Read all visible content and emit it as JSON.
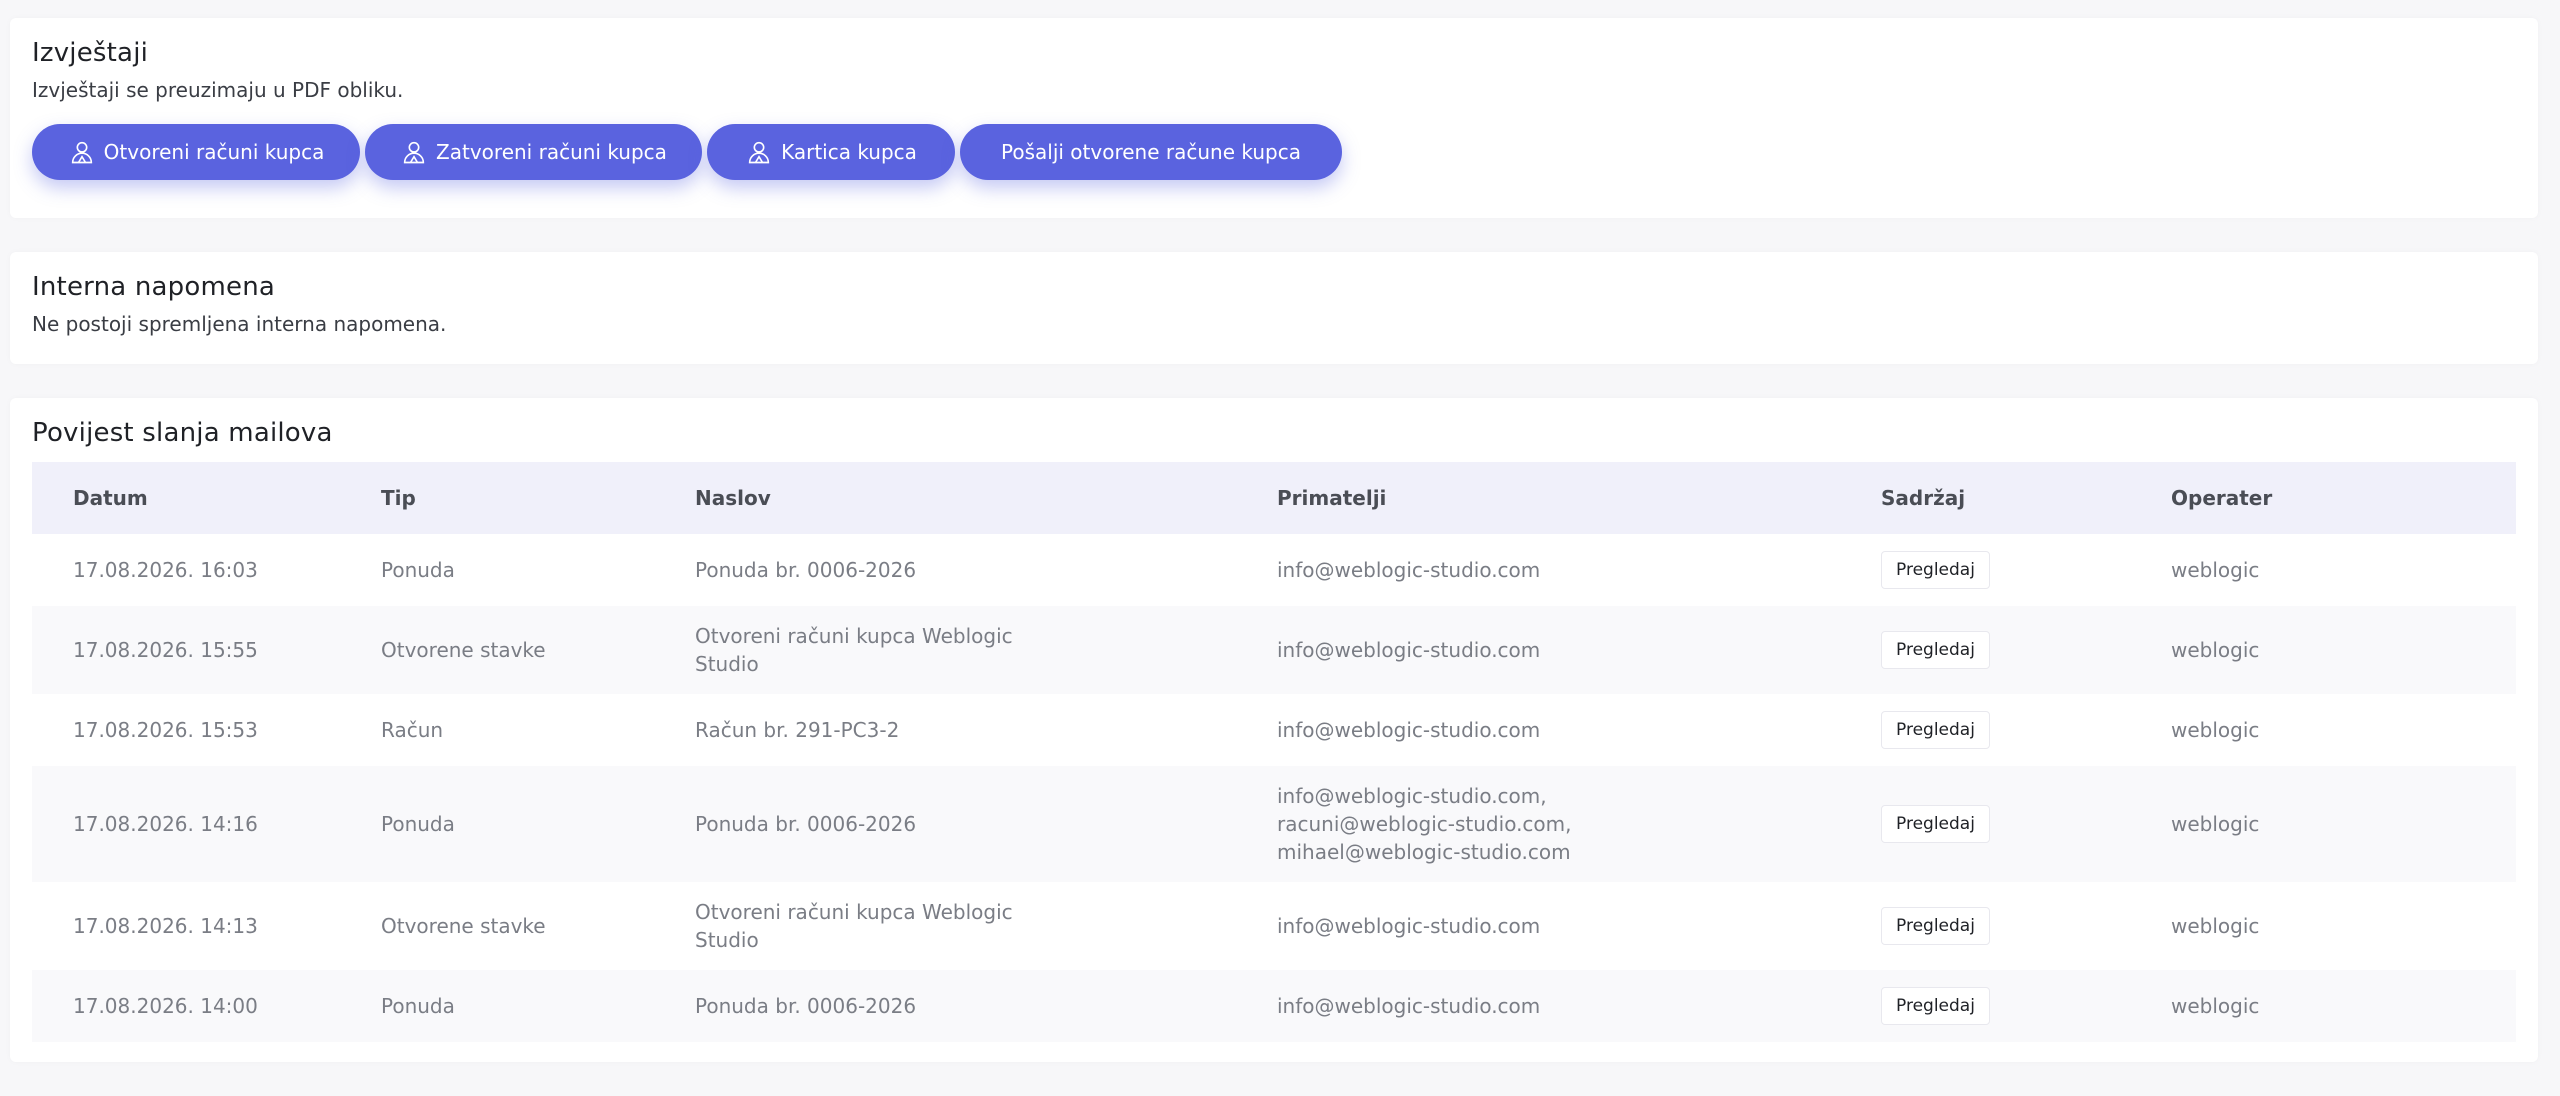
{
  "reports": {
    "title": "Izvještaji",
    "subtitle": "Izvještaji se preuzimaju u PDF obliku.",
    "buttons": [
      {
        "label": "Otvoreni računi kupca",
        "icon": "user-icon"
      },
      {
        "label": "Zatvoreni računi kupca",
        "icon": "user-icon"
      },
      {
        "label": "Kartica kupca",
        "icon": "user-icon"
      },
      {
        "label": "Pošalji otvorene račune kupca",
        "icon": ""
      }
    ]
  },
  "note": {
    "title": "Interna napomena",
    "text": "Ne postoji spremljena interna napomena."
  },
  "mail_history": {
    "title": "Povijest slanja mailova",
    "columns": [
      "Datum",
      "Tip",
      "Naslov",
      "Primatelji",
      "Sadržaj",
      "Operater"
    ],
    "rows": [
      {
        "date": "17.08.2026. 16:03",
        "type": "Ponuda",
        "title": "Ponuda br. 0006-2026",
        "recipients": "info@weblogic-studio.com",
        "content": "Pregledaj",
        "operator": "weblogic"
      },
      {
        "date": "17.08.2026. 15:55",
        "type": "Otvorene stavke",
        "title": "Otvoreni računi kupca Weblogic Studio",
        "recipients": "info@weblogic-studio.com",
        "content": "Pregledaj",
        "operator": "weblogic"
      },
      {
        "date": "17.08.2026. 15:53",
        "type": "Račun",
        "title": "Račun br. 291-PC3-2",
        "recipients": "info@weblogic-studio.com",
        "content": "Pregledaj",
        "operator": "weblogic"
      },
      {
        "date": "17.08.2026. 14:16",
        "type": "Ponuda",
        "title": "Ponuda br. 0006-2026",
        "recipients": "info@weblogic-studio.com,\nracuni@weblogic-studio.com,\nmihael@weblogic-studio.com",
        "content": "Pregledaj",
        "operator": "weblogic"
      },
      {
        "date": "17.08.2026. 14:13",
        "type": "Otvorene stavke",
        "title": "Otvoreni računi kupca Weblogic Studio",
        "recipients": "info@weblogic-studio.com",
        "content": "Pregledaj",
        "operator": "weblogic"
      },
      {
        "date": "17.08.2026. 14:00",
        "type": "Ponuda",
        "title": "Ponuda br. 0006-2026",
        "recipients": "info@weblogic-studio.com",
        "content": "Pregledaj",
        "operator": "weblogic"
      }
    ]
  },
  "colors": {
    "accent": "#5a63df",
    "header_bg": "#f0f0fa",
    "row_alt_bg": "#f9f9fb"
  }
}
